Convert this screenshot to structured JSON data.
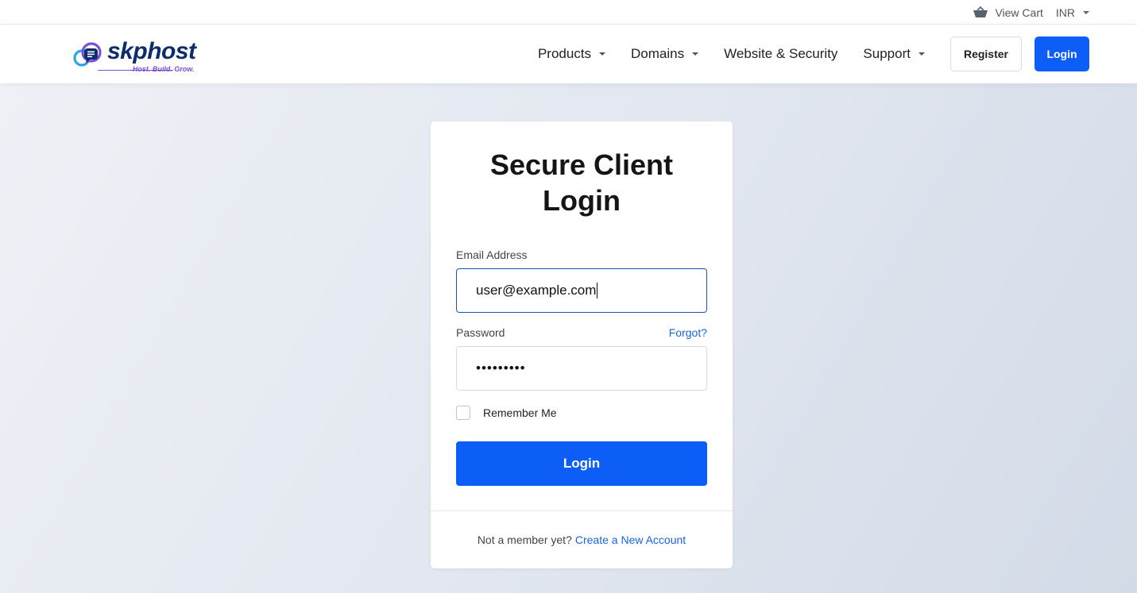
{
  "topbar": {
    "cart_label": "View Cart",
    "cart_icon": "basket-icon",
    "currency": "INR"
  },
  "brand": {
    "name": "skphost",
    "tagline": "Host. Build. Grow.",
    "colors": {
      "primary": "#0c2d6b",
      "accent": "#7a4fd8",
      "secondary": "#2ea3e3"
    }
  },
  "nav": {
    "items": [
      {
        "label": "Products",
        "has_dropdown": true
      },
      {
        "label": "Domains",
        "has_dropdown": true
      },
      {
        "label": "Website & Security",
        "has_dropdown": false
      },
      {
        "label": "Support",
        "has_dropdown": true
      }
    ],
    "register_label": "Register",
    "login_label": "Login"
  },
  "login_card": {
    "title": "Secure Client Login",
    "email_label": "Email Address",
    "email_value": "user@example.com",
    "password_label": "Password",
    "forgot_label": "Forgot?",
    "password_masked": "•••••••••",
    "remember_label": "Remember Me",
    "remember_checked": false,
    "submit_label": "Login",
    "footer_text": "Not a member yet?",
    "footer_link": "Create a New Account"
  },
  "colors": {
    "primary_button": "#0d5ef7",
    "link": "#1865e0",
    "focus_border": "#1a55b8"
  }
}
